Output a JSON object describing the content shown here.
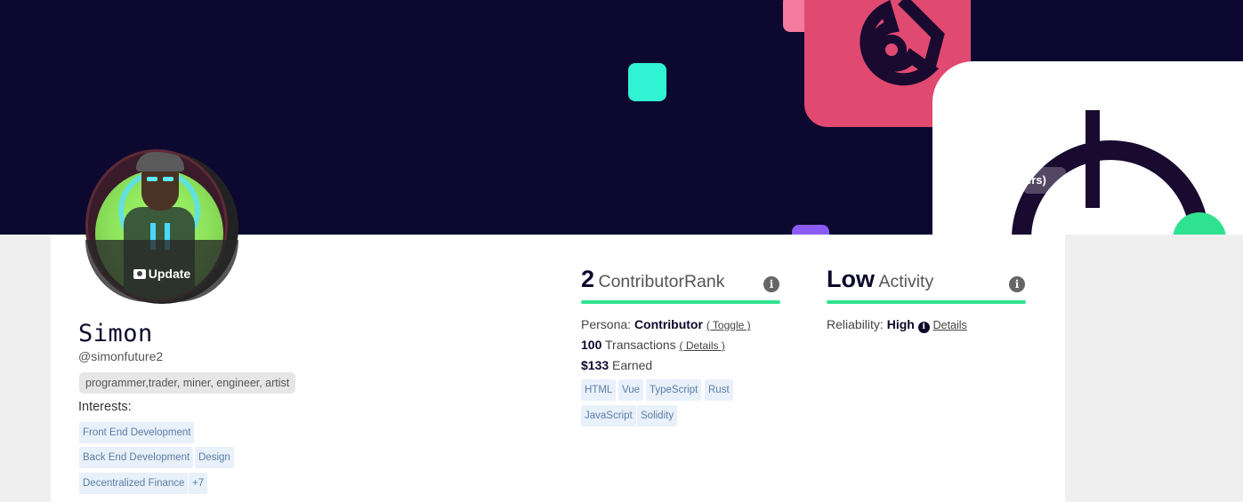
{
  "banner": {
    "tooltip_fragment": "ers)"
  },
  "profile": {
    "avatar_update_label": "Update",
    "name": "Simon",
    "handle": "@simonfuture2",
    "roles": "programmer,trader, miner, engineer, artist",
    "interests_label": "Interests:",
    "interests": [
      "Front End Development",
      "Back End Development",
      "Design",
      "Decentralized Finance",
      "+7"
    ]
  },
  "contributor": {
    "rank_number": "2",
    "rank_label": "ContributorRank",
    "persona_label": "Persona:",
    "persona_value": "Contributor",
    "persona_toggle": "( Toggle )",
    "transactions_count": "100",
    "transactions_label": "Transactions",
    "transactions_details": "( Details )",
    "earned_value": "$133",
    "earned_label": "Earned",
    "skills": [
      "HTML",
      "Vue",
      "TypeScript",
      "Rust",
      "JavaScript",
      "Solidity"
    ]
  },
  "activity": {
    "level": "Low",
    "label": "Activity",
    "reliability_label": "Reliability:",
    "reliability_value": "High",
    "details_link": "Details"
  },
  "colors": {
    "banner_bg": "#0d0830",
    "accent_green": "#2fe28f",
    "tag_bg": "#e8f0fa",
    "tag_text": "#5b7fa6"
  },
  "icons": {
    "camera": "camera-icon",
    "info": "info-icon"
  }
}
